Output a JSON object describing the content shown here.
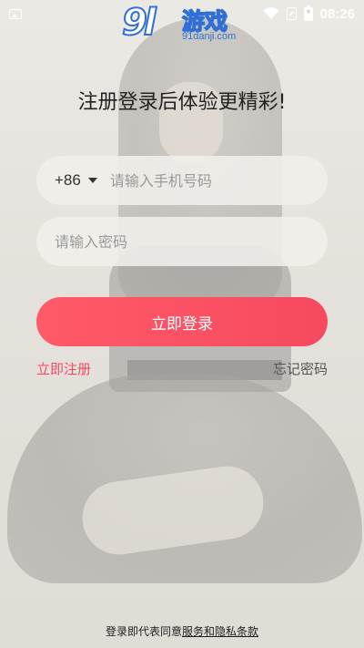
{
  "status_bar": {
    "time": "08:26"
  },
  "watermark": {
    "mark": "9l",
    "name": "游戏",
    "domain": "91danji.com"
  },
  "login": {
    "headline": "注册登录后体验更精彩!",
    "country_code": "+86",
    "phone_placeholder": "请输入手机号码",
    "password_placeholder": "请输入密码",
    "login_label": "立即登录",
    "register_label": "立即注册",
    "forgot_label": "忘记密码"
  },
  "agreement": {
    "prefix": "登录即代表同意",
    "service_link": "服务",
    "conjunction": "和",
    "privacy_link": "隐私条款"
  },
  "colors": {
    "accent": "#f64a5e",
    "register_link": "#f04a63",
    "watermark_blue": "#2f6fd6"
  },
  "icons": [
    "gallery-icon",
    "wifi-icon",
    "sim-icon",
    "battery-icon",
    "chevron-down-icon"
  ]
}
